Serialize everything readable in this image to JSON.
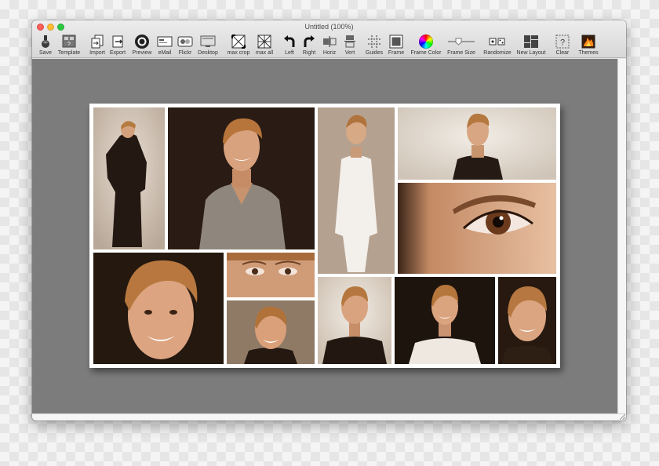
{
  "window": {
    "title": "Untitled (100%)"
  },
  "toolbar": {
    "save": "Save",
    "template": "Template",
    "import": "Import",
    "export": "Export",
    "preview": "Preview",
    "email": "eMail",
    "flickr": "Flickr",
    "desktop": "Desktop",
    "max_crop": "max crop",
    "max_all": "max all",
    "left": "Left",
    "right": "Right",
    "horiz": "Horiz",
    "vert": "Vert",
    "guides": "Guides",
    "frame": "Frame",
    "frame_color": "Frame Color",
    "frame_size": "Frame Size",
    "randomize": "Randomize",
    "new_layout": "New Layout",
    "clear": "Clear",
    "themes": "Themes"
  },
  "colors": {
    "canvas": "#7c7c7c",
    "frame": "#ffffff",
    "sepia_light": "#d9c7b4",
    "sepia_dark": "#2a1e17"
  },
  "collage": {
    "photos": [
      "full-body-dark-dress",
      "portrait-grey-top-dark-bg",
      "full-body-white-outfit",
      "portrait-dark-top-light-bg",
      "eye-closeup",
      "face-closeup-dark-bg",
      "eyes-crop",
      "smiling-face-small",
      "portrait-black-top-light-bg",
      "portrait-white-top-dark-bg",
      "face-closeup-right"
    ]
  }
}
